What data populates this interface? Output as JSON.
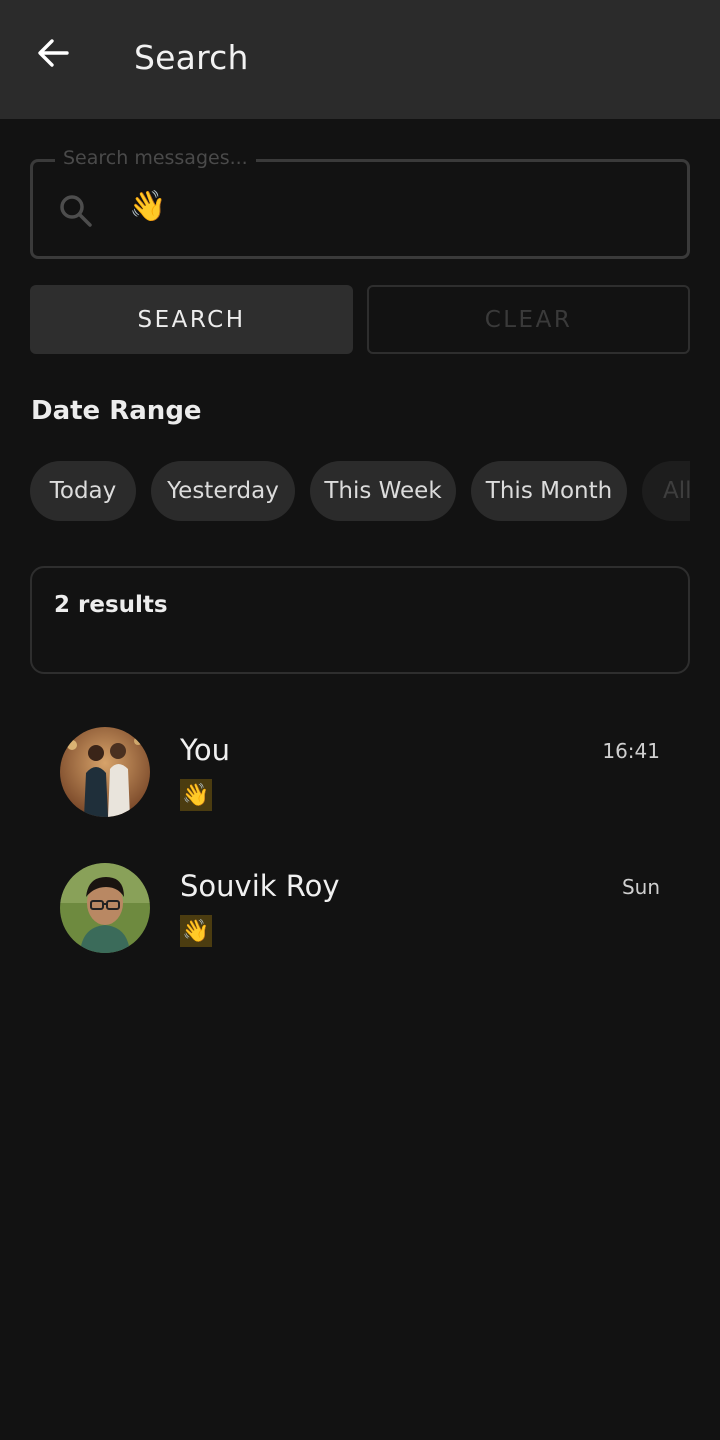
{
  "header": {
    "title": "Search",
    "back_icon": "arrow-left-icon"
  },
  "search": {
    "placeholder": "Search messages...",
    "value": "👋",
    "search_label": "SEARCH",
    "clear_label": "CLEAR"
  },
  "date_range": {
    "label": "Date Range",
    "chips": [
      "Today",
      "Yesterday",
      "This Week",
      "This Month",
      "All"
    ]
  },
  "results": {
    "count_text": "2 results",
    "items": [
      {
        "sender": "You",
        "time": "16:41",
        "message": "👋"
      },
      {
        "sender": "Souvik Roy",
        "time": "Sun",
        "message": "👋"
      }
    ]
  },
  "colors": {
    "background": "#121212",
    "app_bar": "#2b2b2b",
    "chip": "#2b2b2b",
    "emoji_bg": "#4b3c10"
  }
}
